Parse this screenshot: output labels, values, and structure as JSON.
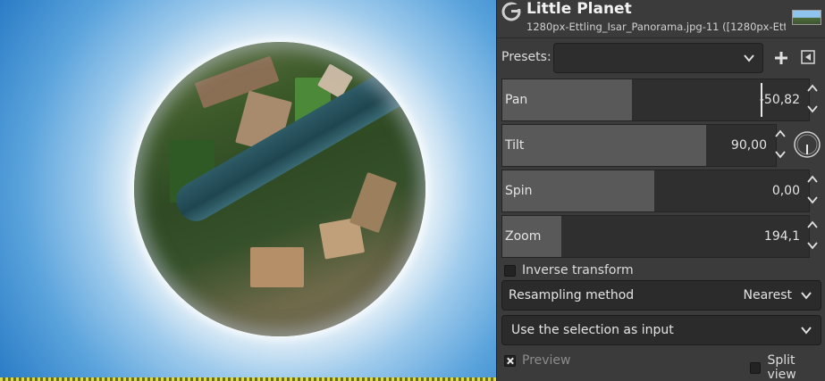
{
  "dialog": {
    "title": "Little Planet",
    "subtitle": "1280px-Ettling_Isar_Panorama.jpg-11 ([1280px-Ettl..."
  },
  "presets": {
    "label": "Presets:",
    "value": ""
  },
  "controls": [
    {
      "key": "pan",
      "label": "Pan",
      "value": "-50,82",
      "fill_fraction": 0.42
    },
    {
      "key": "tilt",
      "label": "Tilt",
      "value": "90,00",
      "fill_fraction": 0.74
    },
    {
      "key": "spin",
      "label": "Spin",
      "value": "0,00",
      "fill_fraction": 0.49
    },
    {
      "key": "zoom",
      "label": "Zoom",
      "value": "194,1",
      "fill_fraction": 0.19
    }
  ],
  "inverse_transform": {
    "label": "Inverse transform",
    "checked": false
  },
  "resampling": {
    "label": "Resampling method",
    "value": "Nearest"
  },
  "input_source": {
    "value": "Use the selection as input"
  },
  "preview": {
    "label": "Preview",
    "checked": true
  },
  "split_view": {
    "label": "Split view",
    "checked": false
  },
  "icons": [
    "gimp-logo-icon",
    "image-thumbnail-icon",
    "chevron-down-icon",
    "plus-icon",
    "menu-arrow-icon",
    "spin-up-icon",
    "spin-down-icon",
    "tilt-dial-icon"
  ],
  "colors": {
    "panel_bg": "#3b3b3b",
    "scale_fill": "#595959",
    "scale_track": "#2f2f2f",
    "sky": "#5aa3dc"
  }
}
